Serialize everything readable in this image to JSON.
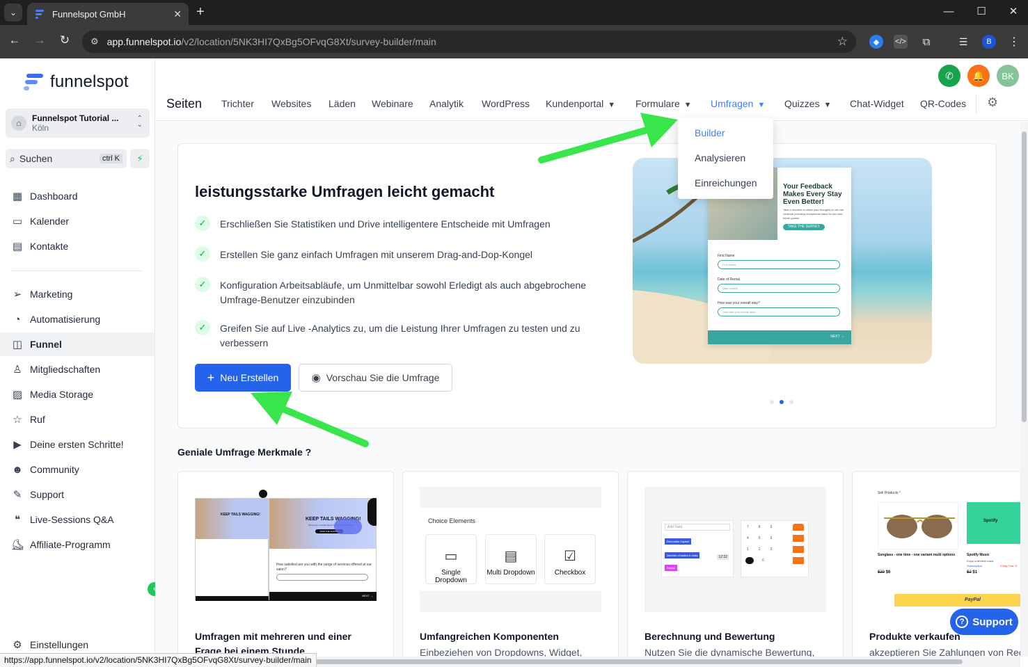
{
  "browser": {
    "tab_title": "Funnelspot GmbH",
    "url_host": "app.funnelspot.io",
    "url_path": "/v2/location/5NK3HI7QxBg5OFvqG8Xt/survey-builder/main",
    "status_url": "https://app.funnelspot.io/v2/location/5NK3HI7QxBg5OFvqG8Xt/survey-builder/main",
    "profile_initial": "B"
  },
  "brand": {
    "name": "funnelspot",
    "colors": {
      "accent": "#2563eb",
      "green": "#22c55e",
      "orange": "#f97316",
      "avatar": "#86c39b"
    }
  },
  "account": {
    "name": "Funnelspot Tutorial ...",
    "location": "Köln"
  },
  "search": {
    "label": "Suchen",
    "shortcut": "ctrl K"
  },
  "sidebar": {
    "items": [
      {
        "label": "Dashboard",
        "icon": "dashboard-icon"
      },
      {
        "label": "Kalender",
        "icon": "calendar-icon"
      },
      {
        "label": "Kontakte",
        "icon": "contacts-icon"
      },
      {
        "label": "Marketing",
        "icon": "send-icon"
      },
      {
        "label": "Automatisierung",
        "icon": "automation-icon"
      },
      {
        "label": "Funnel",
        "icon": "funnel-icon"
      },
      {
        "label": "Mitgliedschaften",
        "icon": "membership-icon"
      },
      {
        "label": "Media Storage",
        "icon": "image-icon"
      },
      {
        "label": "Ruf",
        "icon": "star-icon"
      },
      {
        "label": "Deine ersten Schritte!",
        "icon": "play-icon"
      },
      {
        "label": "Community",
        "icon": "community-icon"
      },
      {
        "label": "Support",
        "icon": "wrench-icon"
      },
      {
        "label": "Live-Sessions Q&A",
        "icon": "chat-icon"
      },
      {
        "label": "Affiliate-Programm",
        "icon": "affiliate-icon"
      }
    ],
    "settings_label": "Einstellungen"
  },
  "topnav": {
    "title": "Seiten",
    "items": [
      "Trichter",
      "Websites",
      "Läden",
      "Webinare",
      "Analytik",
      "WordPress",
      "Kundenportal",
      "Formulare",
      "Umfragen",
      "Quizzes",
      "Chat-Widget",
      "QR-Codes"
    ],
    "avatar_initials": "BK"
  },
  "dropdown": {
    "items": [
      "Builder",
      "Analysieren",
      "Einreichungen"
    ],
    "selected": "Builder"
  },
  "hero": {
    "title": "leistungsstarke Umfragen leicht gemacht",
    "features": [
      "Erschließen Sie Statistiken und Drive intelligentere Entscheide mit Umfragen",
      "Erstellen Sie ganz einfach Umfragen mit unserem Drag-and-Dop-Kongel",
      "Konfiguration Arbeitsabläufe, um Unmittelbar sowohl Erledigt als auch abgebrochene Umfrage-Benutzer einzubinden",
      "Greifen Sie auf Live -Analytics zu, um die Leistung Ihrer Umfragen zu testen und zu verbessern"
    ],
    "primary_button": "Neu Erstellen",
    "secondary_button": "Vorschau Sie die Umfrage",
    "preview": {
      "headline": "Your Feedback Makes Every Stay Even Better!",
      "body": "Take a moment to share your thoughts so we can continue providing exceptional stays for you and future guests.",
      "cta": "TAKE THE SURVEY",
      "field1_label": "First Name",
      "field1_placeholder": "First Name",
      "field2_label": "Date of Rental",
      "field2_placeholder": "Date of birth",
      "field3_label": "How was your overall stay?",
      "field3_placeholder": "How was your overall stay?",
      "next": "NEXT →"
    },
    "carousel": {
      "count": 3,
      "active": 2
    }
  },
  "features_section": {
    "title": "Geniale Umfrage Merkmale ?",
    "cards": [
      {
        "title": "Umfragen mit mehreren und einer Frage bei einem Stunde",
        "desc": ""
      },
      {
        "title": "Umfangreichen Komponenten",
        "desc": "Einbeziehen von Dropdowns, Widget,"
      },
      {
        "title": "Berechnung und Bewertung",
        "desc": "Nutzen Sie die dynamische Bewertung,"
      },
      {
        "title": "Produkte verkaufen",
        "desc": "akzeptieren Sie Zahlungen von Rec"
      }
    ],
    "card1_image": {
      "headline": "KEEP TAILS WAGGING!",
      "sub": "We'd Love to Know About Your Pup's Pampering!",
      "cta": "TAKE THE SURVEY",
      "question": "How satisfied are you with the range of services offered at our salon?",
      "next": "NEXT →"
    },
    "card2_image": {
      "heading": "Choice Elements",
      "choices": [
        "Single Dropdown",
        "Multi Dropdown",
        "Checkbox"
      ]
    },
    "card3_image": {
      "field": "Add Field",
      "tag1": "Remodels Capital",
      "tag2": "Number of states in India",
      "tag3": "Rental",
      "value": "12:32",
      "keys": [
        "7",
        "8",
        "9",
        "4",
        "5",
        "6",
        "1",
        "2",
        "3",
        "0"
      ]
    },
    "card4_image": {
      "heading": "Sell Products *",
      "p1_name": "Sunglass - one time - one variant multi options",
      "p1_old": "$20",
      "p1_new": "$6",
      "p2_name": "Spotify Music",
      "p2_sub": "Enjoy unlimited music",
      "p2_tag1": "Subscription",
      "p2_tag2": "3 Day Free Tr",
      "p2_old": "$2",
      "p2_new": "$1",
      "paypal": "PayPal",
      "spotify": "Spotify"
    }
  },
  "support_widget": {
    "label": "Support"
  }
}
